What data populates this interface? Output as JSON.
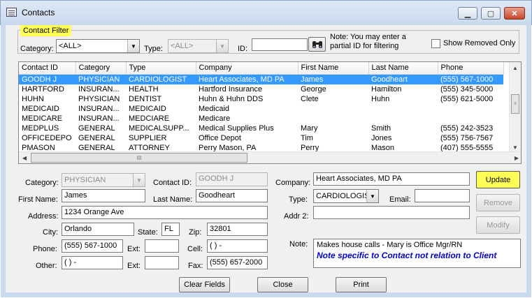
{
  "window": {
    "title": "Contacts",
    "minimize_glyph": "▁",
    "maximize_glyph": "▢",
    "close_glyph": "✕"
  },
  "filter": {
    "group_label": "Contact Filter",
    "category_label": "Category:",
    "category_value": "<ALL>",
    "type_label": "Type:",
    "type_value": "<ALL>",
    "id_label": "ID:",
    "id_value": "",
    "note": "Note: You may enter a partial ID for filtering",
    "show_removed_label": "Show Removed Only"
  },
  "grid": {
    "columns": [
      "Contact ID",
      "Category",
      "Type",
      "Company",
      "First Name",
      "Last Name",
      "Phone"
    ],
    "rows": [
      [
        "GOODH J",
        "PHYSICIAN",
        "CARDIOLOGIST",
        "Heart Associates, MD PA",
        "James",
        "Goodheart",
        "(555) 567-1000"
      ],
      [
        "HARTFORD",
        "INSURAN...",
        "HEALTH",
        "Hartford Insurance",
        "George",
        "Hamilton",
        "(555) 345-5000"
      ],
      [
        "HUHN",
        "PHYSICIAN",
        "DENTIST",
        "Huhn & Huhn DDS",
        "Clete",
        "Huhn",
        "(555) 621-5000"
      ],
      [
        "MEDICAID",
        "INSURAN...",
        "MEDICAID",
        "Medicaid",
        "",
        "",
        ""
      ],
      [
        "MEDICARE",
        "INSURAN...",
        "MEDCIARE",
        "Medicare",
        "",
        "",
        ""
      ],
      [
        "MEDPLUS",
        "GENERAL",
        "MEDICALSUPP...",
        "Medical Supplies Plus",
        "Mary",
        "Smith",
        "(555) 242-3523"
      ],
      [
        "OFFICEDEPO",
        "GENERAL",
        "SUPPLIER",
        "Office Depot",
        "Tim",
        "Jones",
        "(555) 756-7567"
      ],
      [
        "PMASON",
        "GENERAL",
        "ATTORNEY",
        "Perry Mason, PA",
        "Perry",
        "Mason",
        "(407) 555-5555"
      ]
    ],
    "selected_row": 0,
    "scroll_glyph": "III"
  },
  "detail": {
    "category_label": "Category:",
    "category_value": "PHYSICIAN",
    "contact_id_label": "Contact ID:",
    "contact_id_value": "GOODH J",
    "company_label": "Company:",
    "company_value": "Heart Associates, MD PA",
    "first_name_label": "First Name:",
    "first_name_value": "James",
    "last_name_label": "Last Name:",
    "last_name_value": "Goodheart",
    "type_label": "Type:",
    "type_value": "CARDIOLOGIS",
    "email_label": "Email:",
    "email_value": "",
    "address_label": "Address:",
    "address_value": "1234 Orange Ave",
    "addr2_label": "Addr 2:",
    "addr2_value": "",
    "city_label": "City:",
    "city_value": "Orlando",
    "state_label": "State:",
    "state_value": "FL",
    "zip_label": "Zip:",
    "zip_value": "32801",
    "phone_label": "Phone:",
    "phone_value": "(555) 567-1000",
    "ext_label": "Ext:",
    "ext_value": "",
    "cell_label": "Cell:",
    "cell_value": "(   )   -",
    "other_label": "Other:",
    "other_value": "(   )   -",
    "ext2_label": "Ext:",
    "ext2_value": "",
    "fax_label": "Fax:",
    "fax_value": "(555) 657-2000",
    "note_label": "Note:",
    "note_value": "Makes house calls - Mary is Office Mgr/RN",
    "note_blue": "Note specific to Contact not relation to Client"
  },
  "buttons": {
    "update": "Update",
    "remove": "Remove",
    "modify": "Modify",
    "clear_fields": "Clear Fields",
    "close": "Close",
    "print": "Print"
  },
  "colors": {
    "highlight": "#ffff55",
    "selection": "#3399ff",
    "note_blue": "#0000cc"
  }
}
